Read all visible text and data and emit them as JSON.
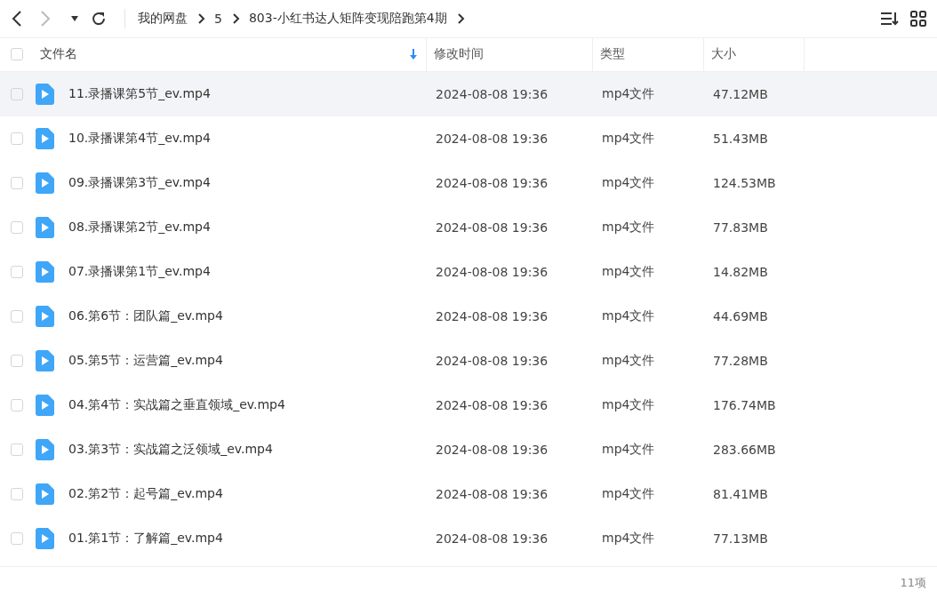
{
  "toolbar": {
    "breadcrumbs": [
      "我的网盘",
      "5",
      "803-小红书达人矩阵变现陪跑第4期"
    ]
  },
  "table": {
    "all_checked": false,
    "columns": [
      {
        "label": "文件名",
        "sorted": true
      },
      {
        "label": "修改时间",
        "sorted": false
      },
      {
        "label": "类型",
        "sorted": false
      },
      {
        "label": "大小",
        "sorted": false
      }
    ],
    "rows": [
      {
        "name": "11.录播课第5节_ev.mp4",
        "modified": "2024-08-08 19:36",
        "type": "mp4文件",
        "size": "47.12MB",
        "checked": false,
        "highlighted": true
      },
      {
        "name": "10.录播课第4节_ev.mp4",
        "modified": "2024-08-08 19:36",
        "type": "mp4文件",
        "size": "51.43MB",
        "checked": false,
        "highlighted": false
      },
      {
        "name": "09.录播课第3节_ev.mp4",
        "modified": "2024-08-08 19:36",
        "type": "mp4文件",
        "size": "124.53MB",
        "checked": false,
        "highlighted": false
      },
      {
        "name": "08.录播课第2节_ev.mp4",
        "modified": "2024-08-08 19:36",
        "type": "mp4文件",
        "size": "77.83MB",
        "checked": false,
        "highlighted": false
      },
      {
        "name": "07.录播课第1节_ev.mp4",
        "modified": "2024-08-08 19:36",
        "type": "mp4文件",
        "size": "14.82MB",
        "checked": false,
        "highlighted": false
      },
      {
        "name": "06.第6节：团队篇_ev.mp4",
        "modified": "2024-08-08 19:36",
        "type": "mp4文件",
        "size": "44.69MB",
        "checked": false,
        "highlighted": false
      },
      {
        "name": "05.第5节：运营篇_ev.mp4",
        "modified": "2024-08-08 19:36",
        "type": "mp4文件",
        "size": "77.28MB",
        "checked": false,
        "highlighted": false
      },
      {
        "name": "04.第4节：实战篇之垂直领域_ev.mp4",
        "modified": "2024-08-08 19:36",
        "type": "mp4文件",
        "size": "176.74MB",
        "checked": false,
        "highlighted": false
      },
      {
        "name": "03.第3节：实战篇之泛领域_ev.mp4",
        "modified": "2024-08-08 19:36",
        "type": "mp4文件",
        "size": "283.66MB",
        "checked": false,
        "highlighted": false
      },
      {
        "name": "02.第2节：起号篇_ev.mp4",
        "modified": "2024-08-08 19:36",
        "type": "mp4文件",
        "size": "81.41MB",
        "checked": false,
        "highlighted": false
      },
      {
        "name": "01.第1节：了解篇_ev.mp4",
        "modified": "2024-08-08 19:36",
        "type": "mp4文件",
        "size": "77.13MB",
        "checked": false,
        "highlighted": false
      }
    ]
  },
  "status_bar": {
    "count": "11项"
  }
}
